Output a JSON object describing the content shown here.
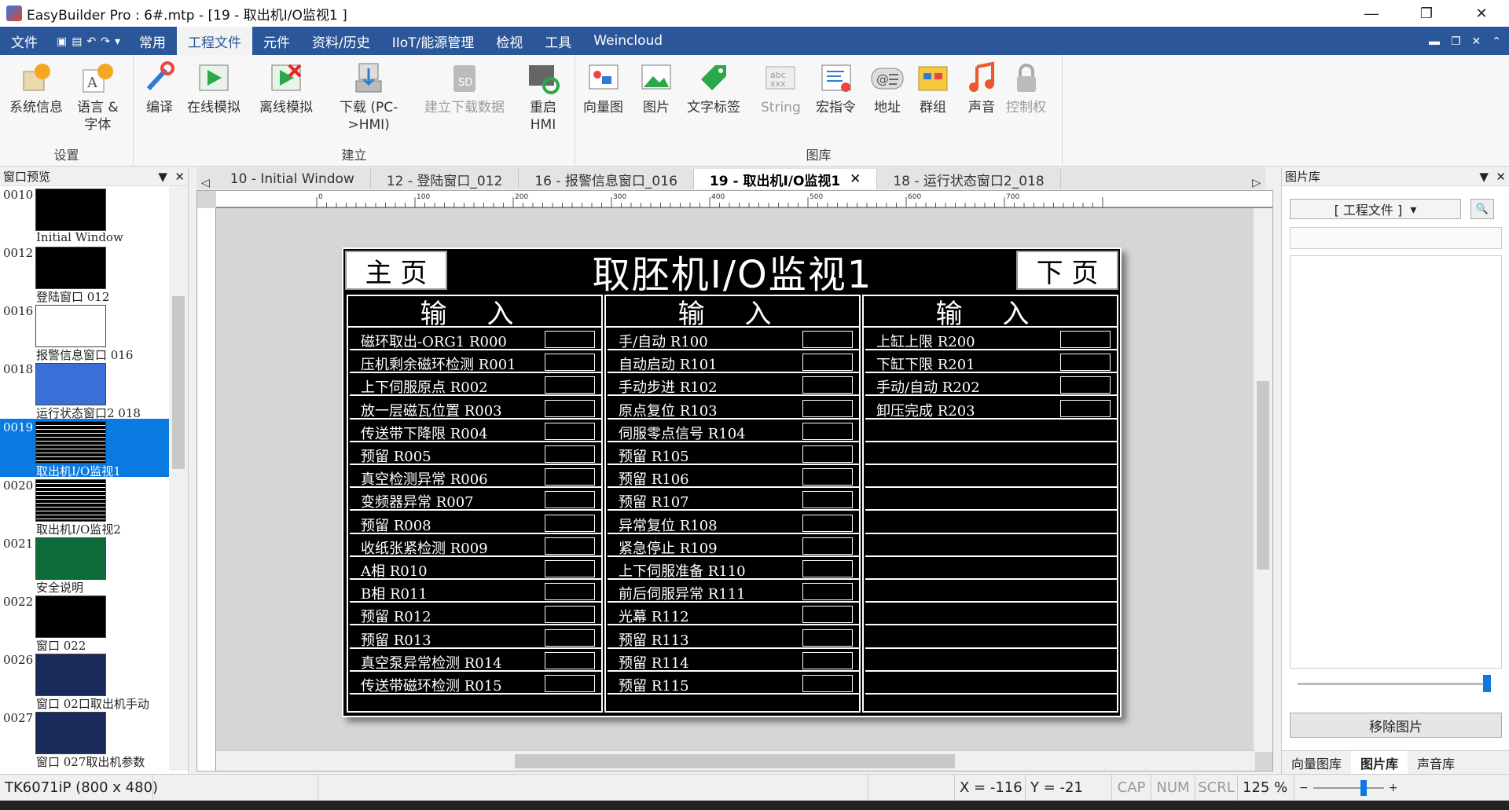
{
  "app": {
    "title": "EasyBuilder Pro : 6#.mtp - [19 - 取出机I/O监视1 ]"
  },
  "menu": {
    "items": [
      "文件",
      "常用",
      "工程文件",
      "元件",
      "资料/历史",
      "IIoT/能源管理",
      "检视",
      "工具",
      "Weincloud"
    ],
    "active": "工程文件"
  },
  "ribbon": {
    "groups": [
      {
        "name": "设置",
        "buttons": [
          {
            "label": "系统信息",
            "icon": "system-info-icon",
            "enabled": true
          },
          {
            "label": "语言 &\n字体",
            "icon": "language-font-icon",
            "enabled": true
          }
        ]
      },
      {
        "name": "建立",
        "buttons": [
          {
            "label": "编译",
            "icon": "compile-icon",
            "enabled": true
          },
          {
            "label": "在线模拟",
            "icon": "online-sim-icon",
            "enabled": true
          },
          {
            "label": "离线模拟",
            "icon": "offline-sim-icon",
            "enabled": true
          },
          {
            "label": "下载 (PC-\n>HMI)",
            "icon": "download-icon",
            "enabled": true
          },
          {
            "label": "建立下载数据",
            "icon": "sd-card-icon",
            "enabled": false
          },
          {
            "label": "重启\nHMI",
            "icon": "restart-hmi-icon",
            "enabled": true
          }
        ]
      },
      {
        "name": "图库",
        "buttons": [
          {
            "label": "向量图",
            "icon": "vector-icon",
            "enabled": true
          },
          {
            "label": "图片",
            "icon": "picture-icon",
            "enabled": true
          },
          {
            "label": "文字标签",
            "icon": "label-icon",
            "enabled": true
          },
          {
            "label": "String",
            "icon": "string-icon",
            "enabled": false
          },
          {
            "label": "宏指令",
            "icon": "macro-icon",
            "enabled": true
          },
          {
            "label": "地址",
            "icon": "address-icon",
            "enabled": true
          },
          {
            "label": "群组",
            "icon": "group-icon",
            "enabled": true
          },
          {
            "label": "声音",
            "icon": "sound-icon",
            "enabled": true
          },
          {
            "label": "控制权",
            "icon": "lock-icon",
            "enabled": false
          }
        ]
      }
    ]
  },
  "left_panel": {
    "title": "窗口预览",
    "items": [
      {
        "num": "0010",
        "label": "Initial Window"
      },
      {
        "num": "0012",
        "label": "登陆窗口 012"
      },
      {
        "num": "0016",
        "label": "报警信息窗口 016"
      },
      {
        "num": "0018",
        "label": "运行状态窗口2 018"
      },
      {
        "num": "0019",
        "label": "取出机I/O监视1",
        "selected": true
      },
      {
        "num": "0020",
        "label": "取出机I/O监视2"
      },
      {
        "num": "0021",
        "label": "安全说明"
      },
      {
        "num": "0022",
        "label": "窗口 022"
      },
      {
        "num": "0026",
        "label": "窗口 02口取出机手动"
      },
      {
        "num": "0027",
        "label": "窗口 027取出机参数"
      }
    ]
  },
  "tabs": [
    {
      "label": "10 - Initial Window"
    },
    {
      "label": "12 - 登陆窗口_012"
    },
    {
      "label": "16 - 报警信息窗口_016"
    },
    {
      "label": "19 - 取出机I/O监视1",
      "active": true
    },
    {
      "label": "18 - 运行状态窗口2_018"
    }
  ],
  "ruler": {
    "ticks": [
      "0",
      "100",
      "200",
      "300",
      "400",
      "500",
      "600",
      "700"
    ]
  },
  "screen": {
    "main_button": "主 页",
    "next_button": "下 页",
    "title": "取胚机I/O监视1",
    "columns": [
      {
        "header": "输 入",
        "rows": [
          "磁环取出-ORG1 R000",
          "压机剩余磁环检测 R001",
          "上下伺服原点 R002",
          "放一层磁瓦位置 R003",
          "传送带下降限 R004",
          "预留 R005",
          "真空检测异常 R006",
          "变频器异常 R007",
          "预留 R008",
          "收纸张紧检测 R009",
          "A相 R010",
          "B相 R011",
          "预留 R012",
          "预留 R013",
          "真空泵异常检测 R014",
          "传送带磁环检测 R015"
        ]
      },
      {
        "header": "输 入",
        "rows": [
          "手/自动 R100",
          "自动启动 R101",
          "手动步进 R102",
          "原点复位 R103",
          "伺服零点信号 R104",
          "预留 R105",
          "预留 R106",
          "预留 R107",
          "异常复位 R108",
          "紧急停止 R109",
          "上下伺服准备 R110",
          "前后伺服异常 R111",
          "光幕 R112",
          "预留 R113",
          "预留 R114",
          "预留 R115"
        ]
      },
      {
        "header": "输 入",
        "rows": [
          "上缸上限 R200",
          "下缸下限 R201",
          "手动/自动 R202",
          "卸压完成 R203"
        ]
      }
    ]
  },
  "right_panel": {
    "title": "图片库",
    "combo_value": "[ 工程文件 ]",
    "remove_button": "移除图片",
    "tabs": [
      "向量图库",
      "图片库",
      "声音库"
    ],
    "active_tab": "图片库"
  },
  "status": {
    "model": "TK6071iP (800 x 480)",
    "x": "X = -116",
    "y": "Y = -21",
    "cap": "CAP",
    "num": "NUM",
    "scrl": "SCRL",
    "zoom": "125 %"
  },
  "colors": {
    "menubar": "#2b579a",
    "selected": "#0a7ae0",
    "hmi_bg": "#000000",
    "hmi_fg": "#ffffff"
  }
}
